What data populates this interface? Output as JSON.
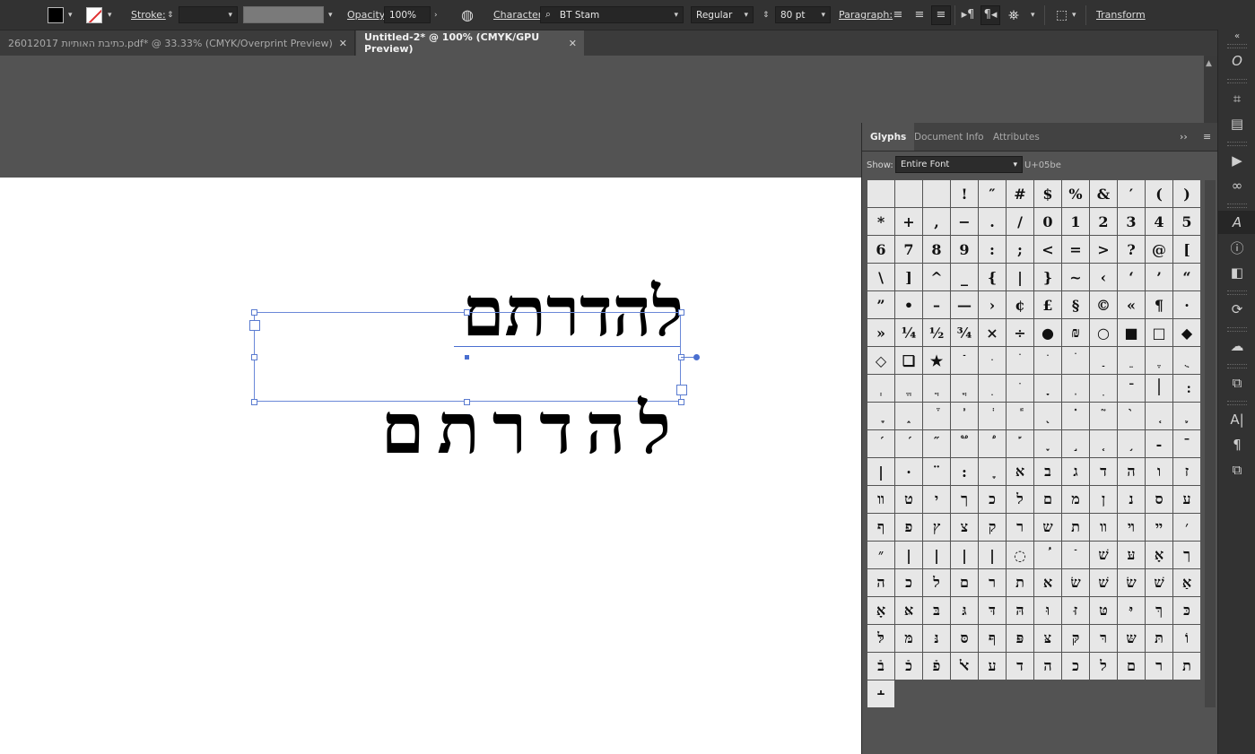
{
  "control_bar": {
    "stroke_label": "Stroke:",
    "opacity_label": "Opacity:",
    "opacity_value": "100%",
    "character_label": "Character:",
    "font_family": "BT Stam",
    "font_style": "Regular",
    "font_size": "80 pt",
    "paragraph_label": "Paragraph:",
    "transform_label": "Transform",
    "icons": [
      "fill-swatch",
      "stroke-swatch",
      "globe-icon",
      "align-left-icon",
      "align-center-icon",
      "align-right-icon",
      "ltr-direction-icon",
      "rtl-direction-icon",
      "paragraph-options-icon",
      "selection-options-icon"
    ]
  },
  "tabs": [
    {
      "label": "26012017  כתיבת  האותיות.pdf* @ 33.33% (CMYK/Overprint Preview)",
      "active": false
    },
    {
      "label": "Untitled-2* @ 100% (CMYK/GPU Preview)",
      "active": true
    }
  ],
  "canvas": {
    "text_top": "להדרתם",
    "text_bottom": "להדרתם"
  },
  "glyphs_panel": {
    "tabs": [
      "Glyphs",
      "Document Info",
      "Attributes"
    ],
    "show_label": "Show:",
    "show_value": "Entire Font",
    "unicode_readout": "U+05be",
    "glyphs": [
      "",
      "",
      "",
      "!",
      "″",
      "#",
      "$",
      "%",
      "&",
      "′",
      "(",
      ")",
      "*",
      "+",
      ",",
      "−",
      ".",
      "/",
      "0",
      "1",
      "2",
      "3",
      "4",
      "5",
      "6",
      "7",
      "8",
      "9",
      ":",
      ";",
      "<",
      "=",
      ">",
      "?",
      "@",
      "[",
      "\\",
      "]",
      "^",
      "_",
      "{",
      "|",
      "}",
      "~",
      "‹",
      "‘",
      "’",
      "“",
      "”",
      "•",
      "–",
      "—",
      "›",
      "¢",
      "£",
      "§",
      "©",
      "«",
      "¶",
      "·",
      "»",
      "¼",
      "½",
      "¾",
      "×",
      "÷",
      "●",
      "₪",
      "○",
      "■",
      "□",
      "◆",
      "◇",
      "❏",
      "★",
      "ֿ",
      "ּ",
      "ׂ",
      "ׁ",
      "ׄ",
      "ַ",
      "ֵ",
      "ֶ",
      "ֻ",
      "ְ",
      "ֱ",
      "ֲ",
      "ֳ",
      "ִ",
      "ֹ",
      "ָ",
      "ֽ",
      "ׅ",
      "־",
      "׀",
      "׃",
      "ׇ",
      "֑",
      "֒",
      "֓",
      "֔",
      "֕",
      "֖",
      "֗",
      "֘",
      "֙",
      "֚",
      "֛",
      "֜",
      "֝",
      "֞",
      "֟",
      "֠",
      "֡",
      "֢",
      "֣",
      "֤",
      "֥",
      "-",
      "¯",
      "|",
      "·",
      "¨",
      ":",
      "ׇ",
      "א",
      "ב",
      "ג",
      "ד",
      "ה",
      "ו",
      "ז",
      "װ",
      "ט",
      "י",
      "ך",
      "כ",
      "ל",
      "ם",
      "מ",
      "ן",
      "נ",
      "ס",
      "ע",
      "ף",
      "פ",
      "ץ",
      "צ",
      "ק",
      "ר",
      "ש",
      "ת",
      "װ",
      "ױ",
      "ײ",
      "׳",
      "״",
      "|",
      "|",
      "|",
      "|",
      "◌",
      "ؙ",
      "ֿ",
      "שׁ",
      "עּ",
      "אָ",
      "ך",
      "ה",
      "כ",
      "ל",
      "ם",
      "ר",
      "ת",
      "ﬡ",
      "שׂ",
      "שׁ",
      "שׂ",
      "שׁ",
      "אַ",
      "אָ",
      "אּ",
      "בּ",
      "גּ",
      "דּ",
      "הּ",
      "וּ",
      "זּ",
      "טּ",
      "יּ",
      "ךּ",
      "כּ",
      "לּ",
      "מּ",
      "נּ",
      "סּ",
      "ףּ",
      "פּ",
      "צּ",
      "קּ",
      "רּ",
      "שּ",
      "תּ",
      "וֹ",
      "בֿ",
      "כֿ",
      "פֿ",
      "ﭏ",
      "ﬠ",
      "ﬢ",
      "ﬣ",
      "ﬤ",
      "ﬥ",
      "ﬦ",
      "ﬧ",
      "ﬨ",
      "﬩"
    ]
  }
}
